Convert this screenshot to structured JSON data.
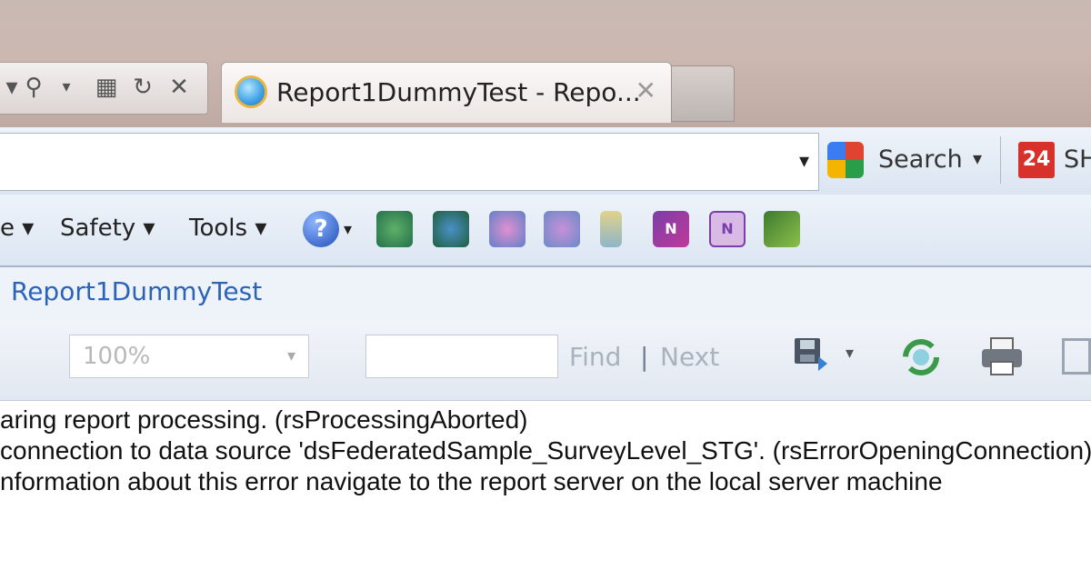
{
  "browser": {
    "tab_title": "Report1DummyTest - Repo...",
    "search_label": "Search",
    "extra_toolbar_label": "SH"
  },
  "commands": {
    "partial_left": "e",
    "safety": "Safety",
    "tools": "Tools"
  },
  "report": {
    "heading": "Report1DummyTest",
    "zoom_value": "100%",
    "find_value": "",
    "find_label": "Find",
    "separator": "|",
    "next_label": "Next"
  },
  "messages": [
    "aring report processing. (rsProcessingAborted)",
    "connection to data source 'dsFederatedSample_SurveyLevel_STG'. (rsErrorOpeningConnection)",
    "nformation about this error navigate to the report server on the local server machine"
  ],
  "colors": {
    "link_blue": "#2d63b7",
    "disabled_gray": "#a9b2bd",
    "chrome_blue": "#dce6f2"
  }
}
